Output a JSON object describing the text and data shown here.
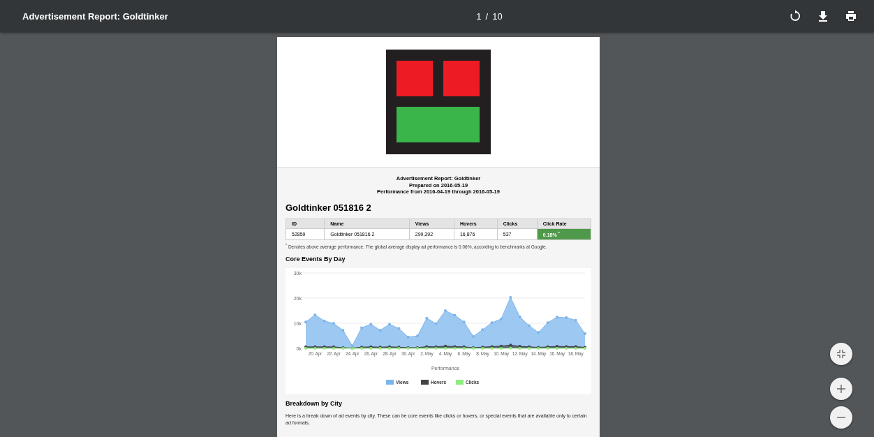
{
  "toolbar": {
    "title": "Advertisement Report: Goldtinker",
    "page_current": "1",
    "page_separator": "/",
    "page_total": "10"
  },
  "report": {
    "header_lines": [
      "Advertisement Report: Goldtinker",
      "Prepared on 2016-05-19",
      "Performance from 2016-04-19 through 2016-05-19"
    ],
    "campaign_title": "Goldtinker 051816 2",
    "table": {
      "columns": [
        "ID",
        "Name",
        "Views",
        "Hovers",
        "Clicks",
        "Click Rate"
      ],
      "rows": [
        {
          "cells": [
            "52859",
            "Goldtinker 051816 2",
            "299,392",
            "16,876",
            "537",
            "0.18% $^{*}$"
          ],
          "highlight_last": true
        }
      ]
    },
    "footnote": "$^{*}$ Denotes above average performance. The global average display ad performance is 0.06%, according to benchmarks at Google.",
    "chart_section_title": "Core Events By Day",
    "chart_data": {
      "type": "area",
      "xlabel": "Performance",
      "categories": [
        null,
        "20. Apr",
        null,
        "22. Apr",
        null,
        "24. Apr",
        null,
        "26. Apr",
        null,
        "28. Apr",
        null,
        "30. Apr",
        null,
        "2. May",
        null,
        "4. May",
        null,
        "6. May",
        null,
        "8. May",
        null,
        "10. May",
        null,
        "12. May",
        null,
        "14. May",
        null,
        "16. May",
        null,
        "18. May",
        null
      ],
      "ylim": [
        0,
        30000
      ],
      "legend": true,
      "yticks": [
        {
          "value": 0,
          "label": "0k"
        },
        {
          "value": 10000,
          "label": "10k"
        },
        {
          "value": 20000,
          "label": "20k"
        },
        {
          "value": 30000,
          "label": "30k"
        }
      ],
      "series": [
        {
          "name": "Views",
          "color": "#7cb5ec",
          "values": [
            10500,
            13300,
            10900,
            9900,
            7200,
            1000,
            8200,
            9600,
            7200,
            9600,
            7900,
            4500,
            4900,
            12000,
            9800,
            15000,
            13200,
            10500,
            4700,
            7400,
            10200,
            11700,
            20300,
            12500,
            9000,
            6300,
            10200,
            12400,
            12200,
            11200,
            5800
          ]
        },
        {
          "name": "Hovers",
          "color": "#434348",
          "values": [
            600,
            600,
            600,
            600,
            300,
            100,
            500,
            600,
            500,
            600,
            500,
            300,
            300,
            700,
            600,
            900,
            700,
            600,
            300,
            500,
            700,
            900,
            1300,
            800,
            600,
            400,
            600,
            800,
            700,
            700,
            400
          ]
        },
        {
          "name": "Clicks",
          "color": "#90ed7d",
          "values": [
            20,
            20,
            20,
            20,
            20,
            0,
            20,
            20,
            20,
            20,
            20,
            10,
            10,
            20,
            20,
            30,
            20,
            20,
            10,
            20,
            20,
            20,
            40,
            20,
            20,
            20,
            20,
            20,
            20,
            20,
            20
          ]
        }
      ]
    },
    "breakdown_title": "Breakdown by City",
    "breakdown_text": "Here is a break down of ad events by city. These can be core events like clicks or hovers, or special events that are available only to certain ad formats."
  }
}
